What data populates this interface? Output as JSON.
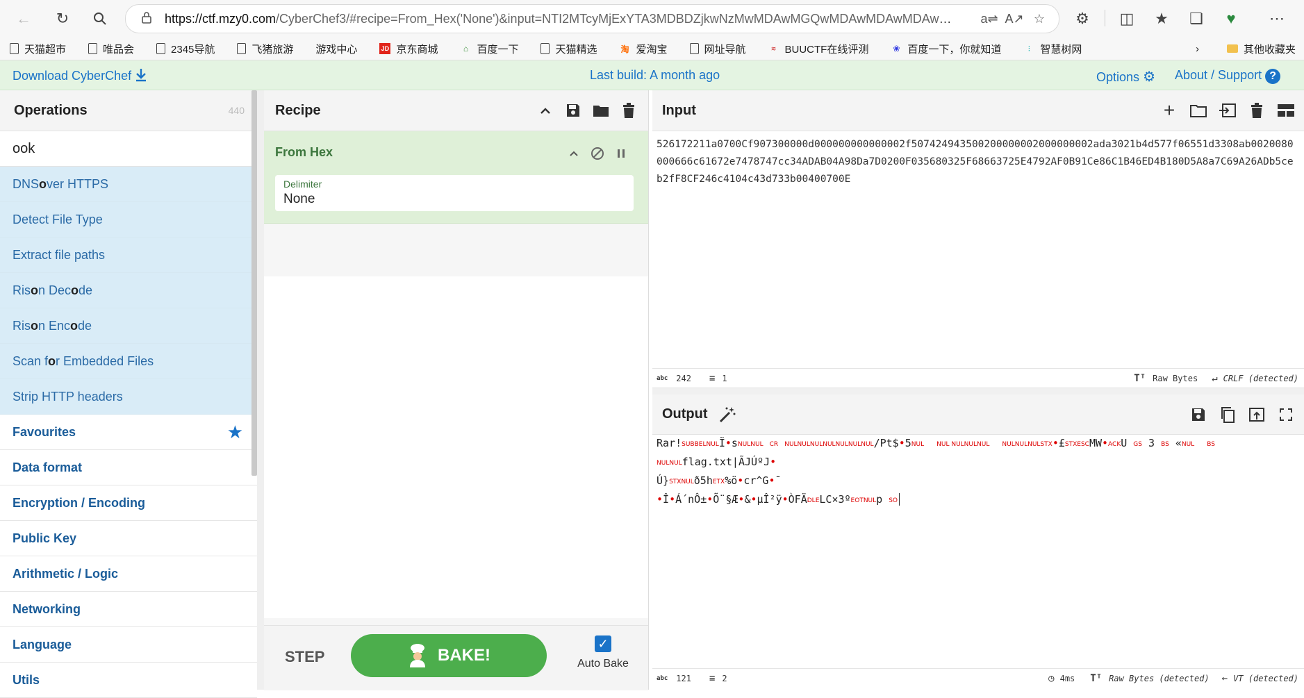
{
  "browser": {
    "url_host": "https://ctf.mzy0.com",
    "url_rest": "/CyberChef3/#recipe=From_Hex('None')&input=NTI2MTcyMjExYTA3MDBDZjkwNzMwMDAwMGQwMDAwMDAwMDAwMD...",
    "bookmarks": [
      "天猫超市",
      "唯品会",
      "2345导航",
      "飞猪旅游",
      "游戏中心",
      "京东商城",
      "百度一下",
      "天猫精选",
      "爱淘宝",
      "网址导航",
      "BUUCTF在线评测",
      "百度一下，你就知道",
      "智慧树网",
      "其他收藏夹"
    ]
  },
  "banner": {
    "download": "Download CyberChef",
    "last_build": "Last build: A month ago",
    "options": "Options",
    "about": "About / Support"
  },
  "operations": {
    "title": "Operations",
    "count": "440",
    "search_value": "ook",
    "results": [
      {
        "pre": "DNS ",
        "hl": "o",
        "post": "ver HTTPS"
      },
      {
        "pre": "Detect File Type",
        "hl": "",
        "post": ""
      },
      {
        "pre": "Extract file paths",
        "hl": "",
        "post": ""
      },
      {
        "pre": "Ris",
        "hl": "o",
        "mid": "n Dec",
        "hl2": "o",
        "post": "de"
      },
      {
        "pre": "Ris",
        "hl": "o",
        "mid": "n Enc",
        "hl2": "o",
        "post": "de"
      },
      {
        "pre": "Scan f",
        "hl": "o",
        "post": "r Embedded Files"
      },
      {
        "pre": "Strip HTTP headers",
        "hl": "",
        "post": ""
      }
    ],
    "categories": [
      "Favourites",
      "Data format",
      "Encryption / Encoding",
      "Public Key",
      "Arithmetic / Logic",
      "Networking",
      "Language",
      "Utils"
    ]
  },
  "recipe": {
    "title": "Recipe",
    "op_name": "From Hex",
    "delimiter_label": "Delimiter",
    "delimiter_value": "None",
    "step": "STEP",
    "bake": "BAKE!",
    "auto_bake": "Auto Bake"
  },
  "input": {
    "title": "Input",
    "text": "526172211a0700Cf907300000d000000000000002f507424943500200000002000000002ada3021b4d577f06551d3308ab0020080000666c61672e7478747cc34ADAB04A98Da7D0200F035680325F68663725E4792AF0B91Ce86C1B46ED4B180D5A8a7C69A26ADb5ceb2fF8CF246c4104c43d733b00400700E",
    "chars": "242",
    "lines": "1",
    "raw": "Raw Bytes",
    "eol": "CRLF (detected)"
  },
  "output": {
    "title": "Output",
    "chars": "121",
    "lines": "2",
    "time": "4ms",
    "raw": "Raw Bytes (detected)",
    "eol": "VT (detected)",
    "line1a": "Rar!",
    "line1b": "Ï",
    "line1c": "s",
    "line1d": "/Pt$",
    "line1e": "5",
    "line1f": "£",
    "line1g": "MW",
    "line1h": "U",
    "line1i": "3",
    "line1j": "«",
    "line1k": "flag.txt|ÃJÚºJ",
    "line2a": "Ú}",
    "line2b": "ð5h",
    "line2c": "%ö",
    "line2d": "cr^G",
    "line2e": "¯",
    "line3a": "Î",
    "line3b": "Á´nÔ±",
    "line3c": "Õ¨§Æ",
    "line3d": "&",
    "line3e": "µÎ²ÿ",
    "line3f": "ÒFÄ",
    "line3g": "LC×3º",
    "line3h": "p",
    "c_sub": "SUB",
    "c_bel": "BEL",
    "c_nul": "NUL",
    "c_cr": "CR",
    "c_nuls": "NULNULNULNULNULNULNUL",
    "c_nul2": "NUL NULNULNUL",
    "c_nulstx": "NULNULNULSTX",
    "c_stxesc": "STXESC",
    "c_ack": "ACK",
    "c_gs": "GS",
    "c_bs": "BS",
    "c_nul3": "NUL",
    "c_bsnul": "BS NULNUL",
    "c_stxnul": "STXNUL",
    "c_etx": "ETX",
    "c_dle": "DLE",
    "c_eotnul": "EOTNUL",
    "c_so": "SO"
  }
}
